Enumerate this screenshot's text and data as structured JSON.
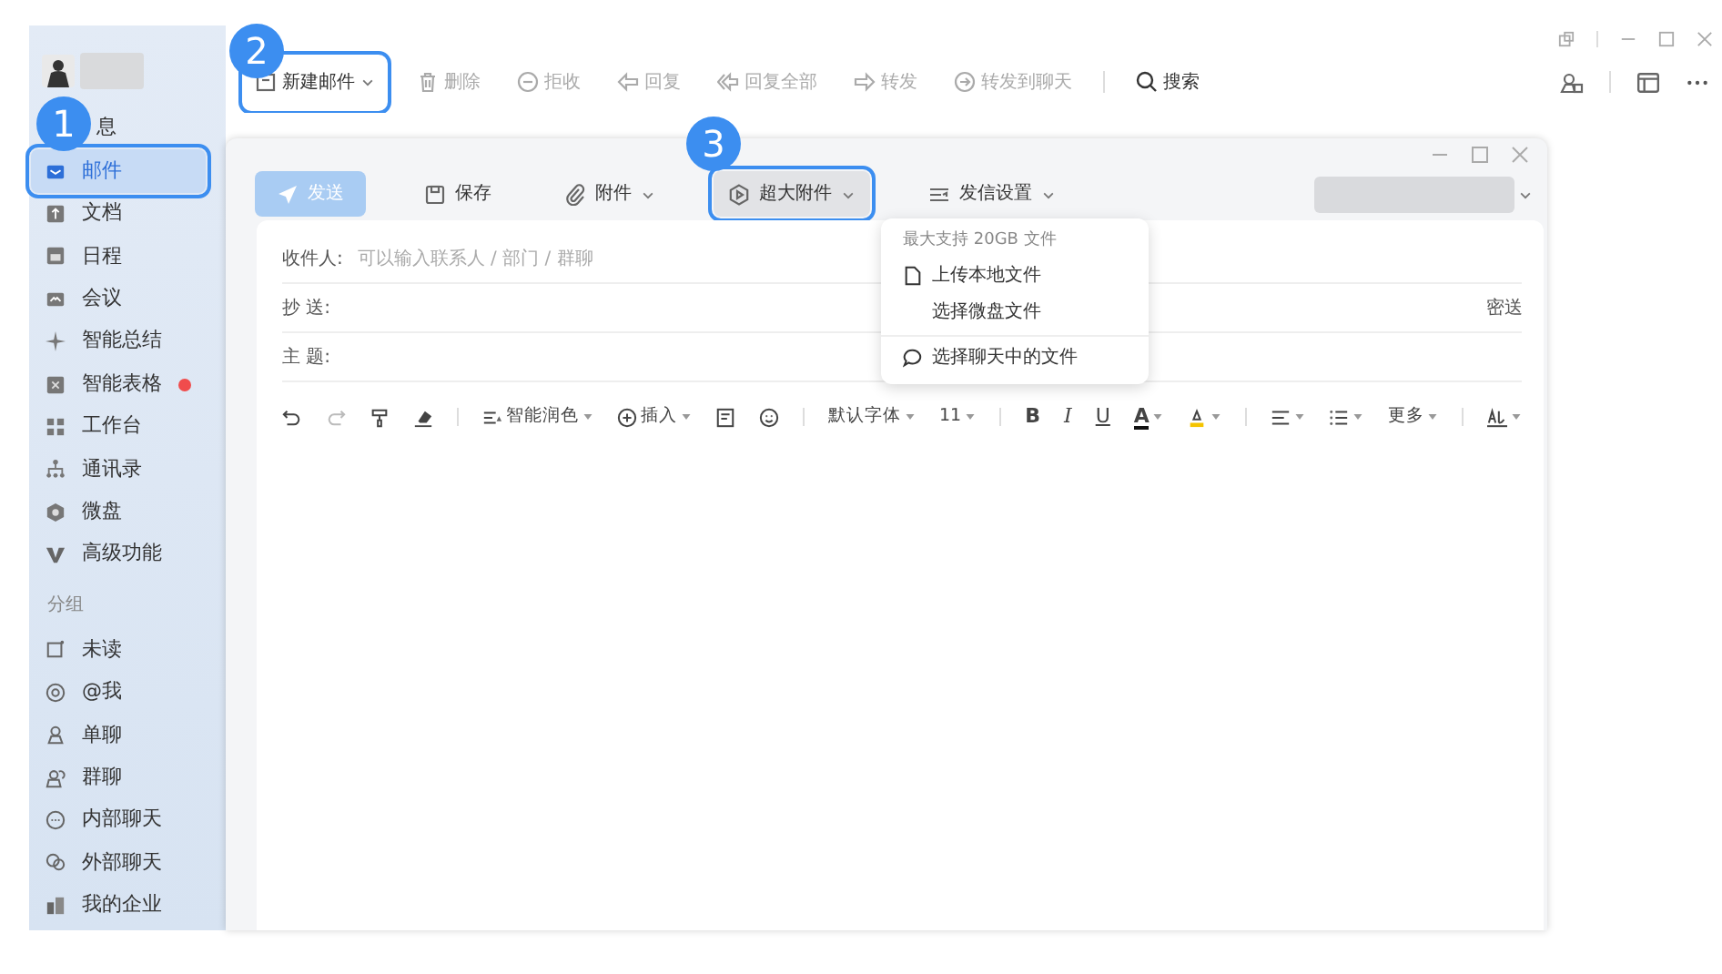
{
  "sidebar": {
    "items": [
      {
        "label": "息",
        "selected": false,
        "unread_dot": false
      },
      {
        "label": "邮件",
        "selected": true,
        "unread_dot": false,
        "annotation": "1"
      },
      {
        "label": "文档",
        "selected": false,
        "unread_dot": false
      },
      {
        "label": "日程",
        "selected": false,
        "unread_dot": false
      },
      {
        "label": "会议",
        "selected": false,
        "unread_dot": false
      },
      {
        "label": "智能总结",
        "selected": false,
        "unread_dot": false
      },
      {
        "label": "智能表格",
        "selected": false,
        "unread_dot": true
      },
      {
        "label": "工作台",
        "selected": false,
        "unread_dot": false
      },
      {
        "label": "通讯录",
        "selected": false,
        "unread_dot": false
      },
      {
        "label": "微盘",
        "selected": false,
        "unread_dot": false
      },
      {
        "label": "高级功能",
        "selected": false,
        "unread_dot": false
      }
    ],
    "section_title": "分组",
    "group_items": [
      {
        "label": "未读",
        "selected": false
      },
      {
        "label": "@我",
        "selected": false
      },
      {
        "label": "单聊",
        "selected": false
      },
      {
        "label": "群聊",
        "selected": false
      },
      {
        "label": "内部聊天",
        "selected": false
      },
      {
        "label": "外部聊天",
        "selected": false
      },
      {
        "label": "我的企业",
        "selected": false
      }
    ]
  },
  "main_toolbar": {
    "buttons": [
      {
        "label": "新建邮件",
        "disabled": false,
        "caret": true,
        "annotation": "2"
      },
      {
        "label": "删除",
        "disabled": true,
        "caret": false
      },
      {
        "label": "拒收",
        "disabled": true,
        "caret": false
      },
      {
        "label": "回复",
        "disabled": true,
        "caret": false
      },
      {
        "label": "回复全部",
        "disabled": true,
        "caret": false
      },
      {
        "label": "转发",
        "disabled": true,
        "caret": false
      },
      {
        "label": "转发到聊天",
        "disabled": true,
        "caret": false
      }
    ],
    "search": {
      "label": "搜索"
    }
  },
  "compose": {
    "toolbar": [
      {
        "label": "发送",
        "kind": "primary",
        "disabled": true,
        "caret": false,
        "pressed": false
      },
      {
        "label": "保存",
        "kind": "plain",
        "disabled": false,
        "caret": false,
        "pressed": false
      },
      {
        "label": "附件",
        "kind": "plain",
        "disabled": false,
        "caret": true,
        "pressed": false
      },
      {
        "label": "超大附件",
        "kind": "plain",
        "disabled": false,
        "caret": true,
        "pressed": true,
        "annotation": "3"
      },
      {
        "label": "发信设置",
        "kind": "plain",
        "disabled": false,
        "caret": true,
        "pressed": false
      }
    ],
    "fields": [
      {
        "label": "收件人:",
        "placeholder": "可以输入联系人 / 部门 / 群聊"
      },
      {
        "label": "抄 送:",
        "extra": "密送"
      },
      {
        "label": "主 题:"
      }
    ],
    "editor_toolbar": [
      {
        "kind": "undo",
        "disabled": false
      },
      {
        "kind": "redo",
        "disabled": true
      },
      {
        "kind": "painter",
        "disabled": false
      },
      {
        "kind": "eraser",
        "disabled": false
      },
      {
        "kind": "sep"
      },
      {
        "kind": "polish",
        "label": "智能润色",
        "caret": true
      },
      {
        "kind": "insert",
        "label": "插入",
        "caret": true
      },
      {
        "kind": "note",
        "disabled": false
      },
      {
        "kind": "emoji",
        "disabled": false
      },
      {
        "kind": "sep"
      },
      {
        "kind": "font",
        "label": "默认字体",
        "caret": true
      },
      {
        "kind": "size",
        "label": "11",
        "caret": true
      },
      {
        "kind": "sep"
      },
      {
        "kind": "bold",
        "label": "B"
      },
      {
        "kind": "italic",
        "label": "I"
      },
      {
        "kind": "underline",
        "label": "U"
      },
      {
        "kind": "fontcolor",
        "label": "A",
        "color": "#111111",
        "caret": true
      },
      {
        "kind": "highlight",
        "color": "#f5c400",
        "caret": true
      },
      {
        "kind": "sep"
      },
      {
        "kind": "align",
        "caret": true
      },
      {
        "kind": "list",
        "caret": true
      },
      {
        "kind": "more",
        "label": "更多",
        "caret": true
      },
      {
        "kind": "sep"
      },
      {
        "kind": "signature",
        "caret": true
      }
    ],
    "menu": {
      "header": "最大支持 20GB 文件",
      "items": [
        {
          "kind": "file",
          "label": "上传本地文件"
        },
        {
          "kind": "plain",
          "label": "选择微盘文件"
        },
        {
          "kind": "divider"
        },
        {
          "kind": "chat",
          "label": "选择聊天中的文件"
        }
      ]
    }
  }
}
